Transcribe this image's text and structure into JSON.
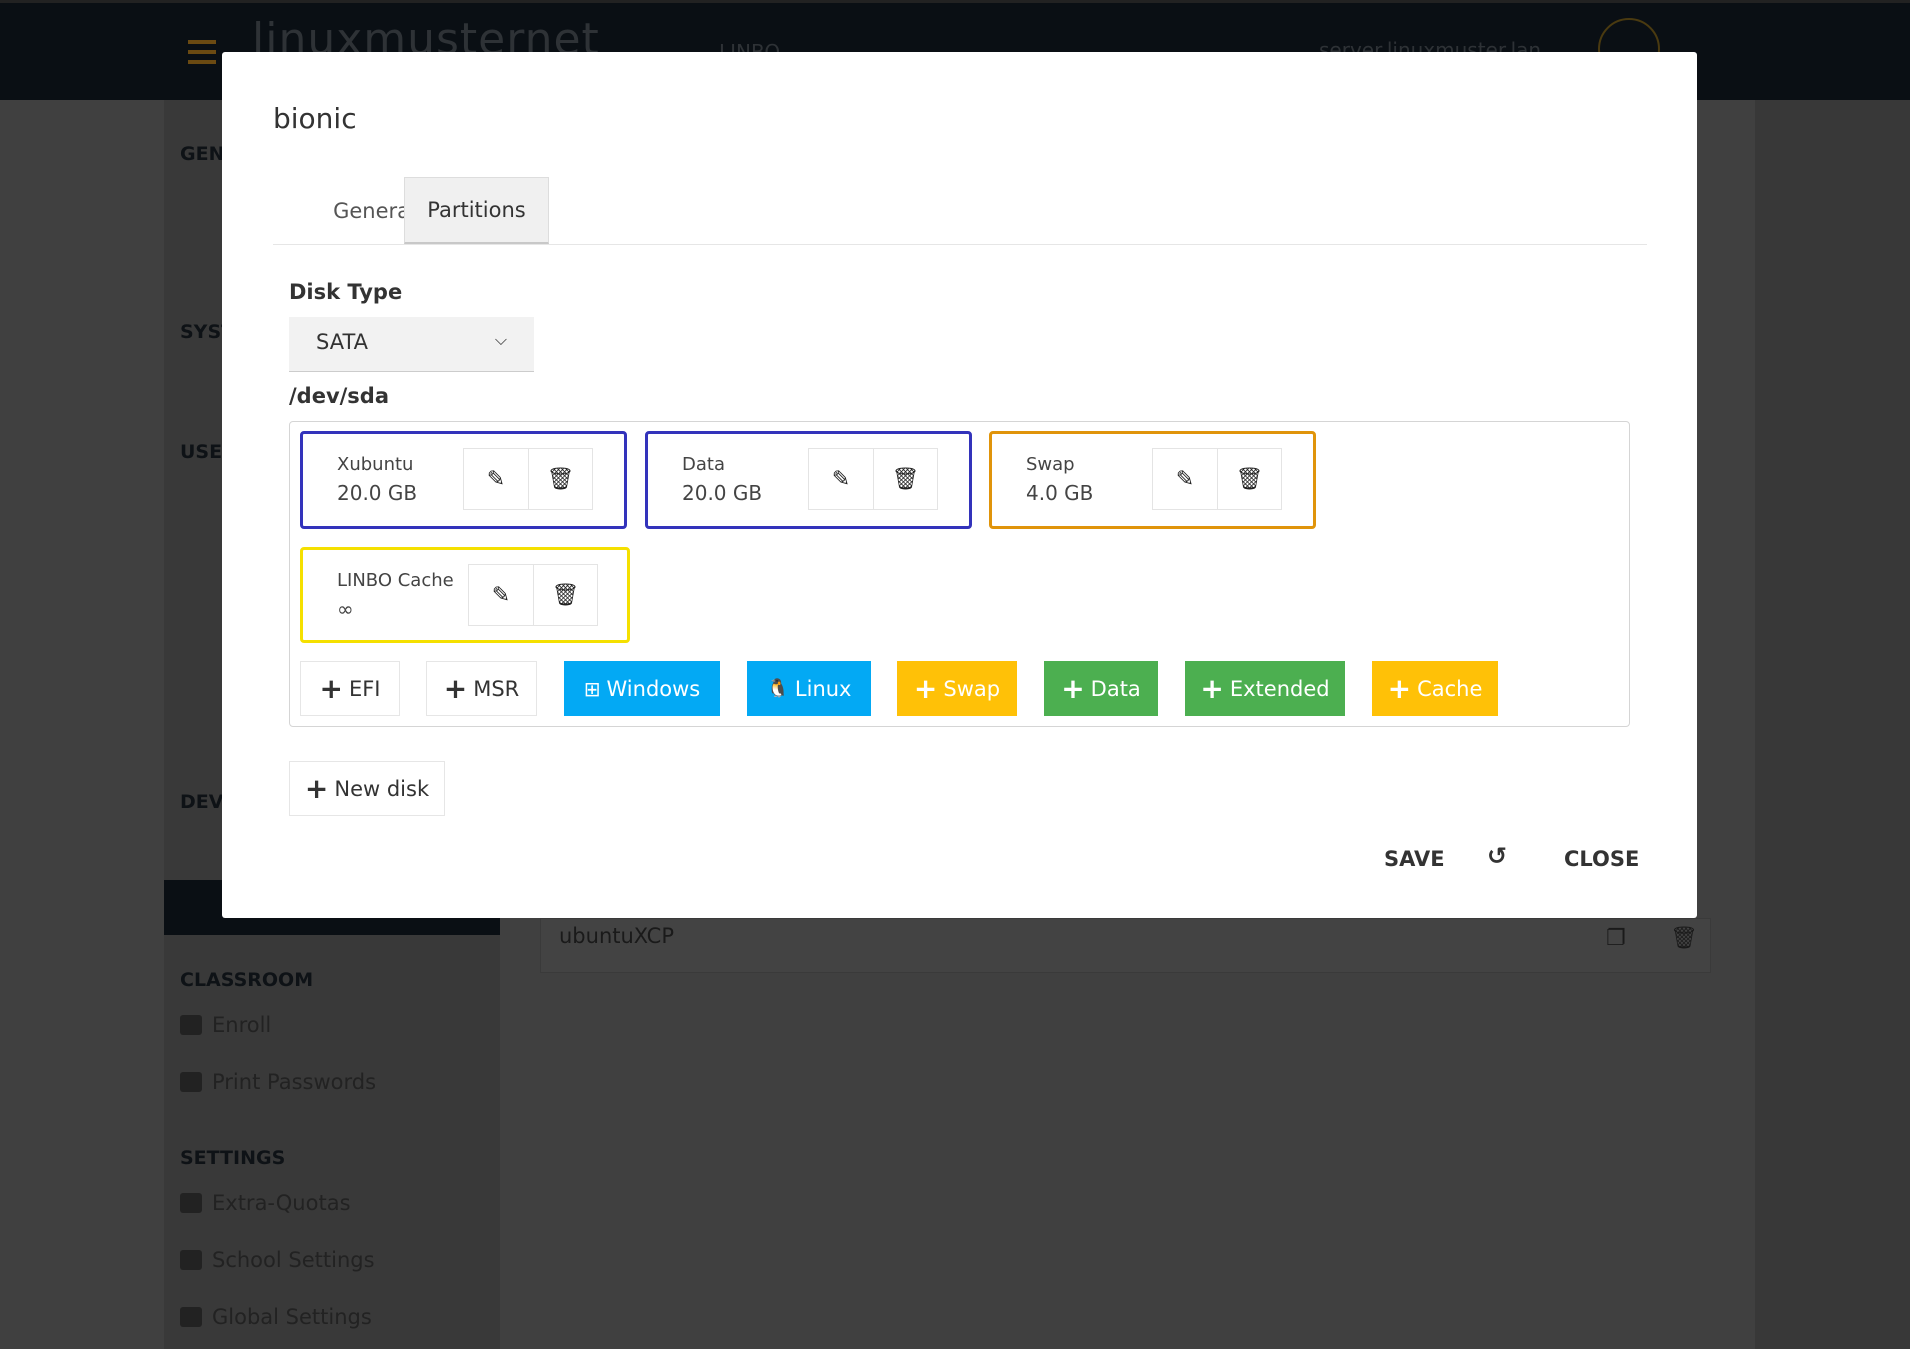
{
  "header": {
    "logo": "linuxmuster",
    "logo_suffix": "net",
    "app": "LINBO",
    "server": "server.linuxmuster.lan"
  },
  "sidebar": {
    "sections": [
      "GENERAL",
      "SYSTEM",
      "USERS",
      "DEVICES",
      "CLASSROOM",
      "SETTINGS"
    ],
    "classroom": [
      "Enroll",
      "Print Passwords"
    ],
    "settings": [
      "Extra-Quotas",
      "School Settings",
      "Global Settings"
    ]
  },
  "main": {
    "row_name": "ubuntuXCP"
  },
  "modal": {
    "title": "bionic",
    "tabs": [
      {
        "label": "General"
      },
      {
        "label": "Partitions",
        "active": true
      }
    ],
    "disk_type_label": "Disk Type",
    "disk_type_value": "SATA",
    "device": "/dev/sda",
    "partitions": [
      {
        "name": "Xubuntu",
        "size": "20.0 GB",
        "color": "#3333bb"
      },
      {
        "name": "Data",
        "size": "20.0 GB",
        "color": "#3333bb"
      },
      {
        "name": "Swap",
        "size": "4.0 GB",
        "color": "#e0940a"
      },
      {
        "name": "LINBO Cache",
        "size": "∞",
        "color": "#f5e000"
      }
    ],
    "add_buttons": [
      {
        "label": "EFI",
        "color": "#ffffff"
      },
      {
        "label": "MSR",
        "color": "#ffffff"
      },
      {
        "label": "Windows",
        "color": "#03a9f4"
      },
      {
        "label": "Linux",
        "color": "#03a9f4"
      },
      {
        "label": "Swap",
        "color": "#ffc107"
      },
      {
        "label": "Data",
        "color": "#4caf50"
      },
      {
        "label": "Extended",
        "color": "#4caf50"
      },
      {
        "label": "Cache",
        "color": "#ffc107"
      }
    ],
    "new_disk": "New disk",
    "save": "SAVE",
    "close": "CLOSE"
  }
}
